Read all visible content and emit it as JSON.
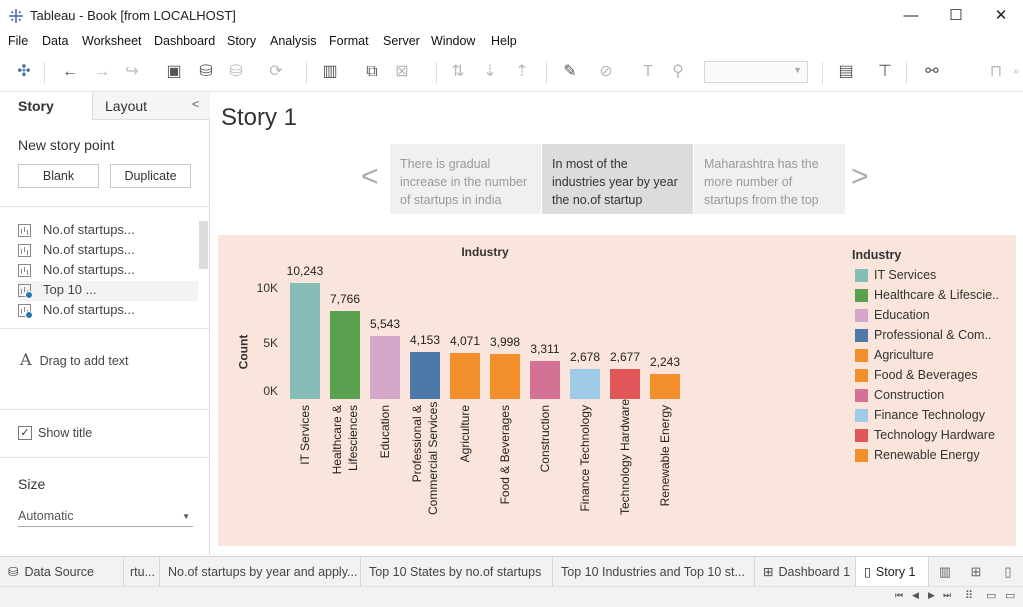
{
  "window": {
    "title": "Tableau - Book [from LOCALHOST]",
    "minimize_icon": "minimize-icon",
    "maximize_icon": "maximize-icon",
    "close_icon": "close-icon"
  },
  "menu": [
    "File",
    "Data",
    "Worksheet",
    "Dashboard",
    "Story",
    "Analysis",
    "Format",
    "Server",
    "Window",
    "Help"
  ],
  "left_panel": {
    "tabs": {
      "story": "Story",
      "layout": "Layout"
    },
    "new_story_point": "New story point",
    "blank_button": "Blank",
    "duplicate_button": "Duplicate",
    "sheets": [
      {
        "label": "No.of startups...",
        "checked": false
      },
      {
        "label": "No.of startups...",
        "checked": false
      },
      {
        "label": "No.of startups...",
        "checked": false
      },
      {
        "label": "Top 10 ...",
        "checked": true
      },
      {
        "label": "No.of startups...",
        "checked": true
      }
    ],
    "drag_text": "Drag to add text",
    "show_title_label": "Show title",
    "show_title_checked": true,
    "size_heading": "Size",
    "size_value": "Automatic"
  },
  "story": {
    "title": "Story 1",
    "points": [
      {
        "text": "There is gradual increase in the number of startups  in india",
        "active": false
      },
      {
        "text": "In most of the industries year by year the no.of startup",
        "active": true
      },
      {
        "text": "Maharashtra has the more number of startups from the top",
        "active": false
      }
    ]
  },
  "chart_data": {
    "type": "bar",
    "title": "Industry",
    "ylabel": "Count",
    "xlabel": "",
    "yticks": [
      "0K",
      "5K",
      "10K"
    ],
    "ylim": [
      0,
      10500
    ],
    "categories": [
      "IT Services",
      "Healthcare & Lifesciences",
      "Education",
      "Professional & Commercial Services",
      "Agriculture",
      "Food & Beverages",
      "Construction",
      "Finance Technology",
      "Technology Hardware",
      "Renewable Energy"
    ],
    "category_labels": [
      [
        "IT Services"
      ],
      [
        "Healthcare &",
        "Lifesciences"
      ],
      [
        "Education"
      ],
      [
        "Professional &",
        "Commercial Services"
      ],
      [
        "Agriculture"
      ],
      [
        "Food & Beverages"
      ],
      [
        "Construction"
      ],
      [
        "Finance Technology"
      ],
      [
        "Technology Hardware"
      ],
      [
        "Renewable Energy"
      ]
    ],
    "values": [
      10243,
      7766,
      5543,
      4153,
      4071,
      3998,
      3311,
      2678,
      2677,
      2243
    ],
    "value_labels": [
      "10,243",
      "7,766",
      "5,543",
      "4,153",
      "4,071",
      "3,998",
      "3,311",
      "2,678",
      "2,677",
      "2,243"
    ],
    "colors": [
      "#86bcb6",
      "#59a14f",
      "#d4a6c8",
      "#4e79a7",
      "#f28e2b",
      "#f28e2b",
      "#d37295",
      "#a0cbe8",
      "#e15759",
      "#f28e2b"
    ],
    "legend": {
      "title": "Industry",
      "position": "right",
      "items": [
        {
          "label": "IT Services",
          "color": "#86bcb6"
        },
        {
          "label": "Healthcare & Lifescie..",
          "color": "#59a14f"
        },
        {
          "label": "Education",
          "color": "#d4a6c8"
        },
        {
          "label": "Professional & Com..",
          "color": "#4e79a7"
        },
        {
          "label": "Agriculture",
          "color": "#f28e2b"
        },
        {
          "label": "Food & Beverages",
          "color": "#f28e2b"
        },
        {
          "label": "Construction",
          "color": "#d37295"
        },
        {
          "label": "Finance Technology",
          "color": "#a0cbe8"
        },
        {
          "label": "Technology Hardware",
          "color": "#e15759"
        },
        {
          "label": "Renewable Energy",
          "color": "#f28e2b"
        }
      ]
    }
  },
  "bottom_tabs": {
    "data_source": "Data Source",
    "tab_partial": "rtu...",
    "tab_yearly": "No.of startups by year and apply...",
    "tab_states": "Top 10 States by no.of startups",
    "tab_industries": "Top 10  Industries and Top 10 st...",
    "tab_dashboard": "Dashboard 1",
    "tab_story": "Story 1"
  }
}
